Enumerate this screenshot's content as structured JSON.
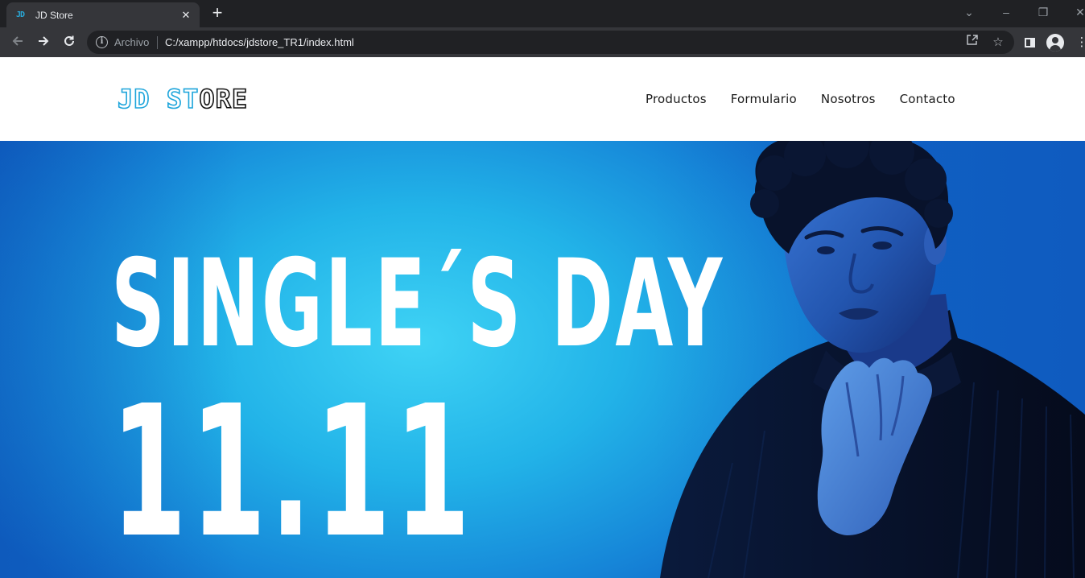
{
  "browser": {
    "tab": {
      "favicon_text": "JD",
      "title": "JD Store"
    },
    "omnibox": {
      "security_label": "Archivo",
      "url": "C:/xampp/htdocs/jdstore_TR1/index.html"
    },
    "icons": {
      "back": "arrow-left-icon",
      "forward": "arrow-right-icon",
      "reload": "reload-icon",
      "share": "share-icon",
      "bookmark": "star-icon",
      "side_panel": "side-panel-icon",
      "profile": "profile-icon",
      "menu": "kebab-menu-icon"
    }
  },
  "site": {
    "logo": {
      "accent": "JD ST",
      "dark": "ORE"
    },
    "nav": [
      "Productos",
      "Formulario",
      "Nosotros",
      "Contacto"
    ],
    "colors": {
      "brand": "#1ea5db",
      "hero_blue": "#1b8fe0",
      "text": "#1a1a1a"
    }
  },
  "hero": {
    "headline": "SINGLE´S DAY",
    "date": "11.11"
  }
}
